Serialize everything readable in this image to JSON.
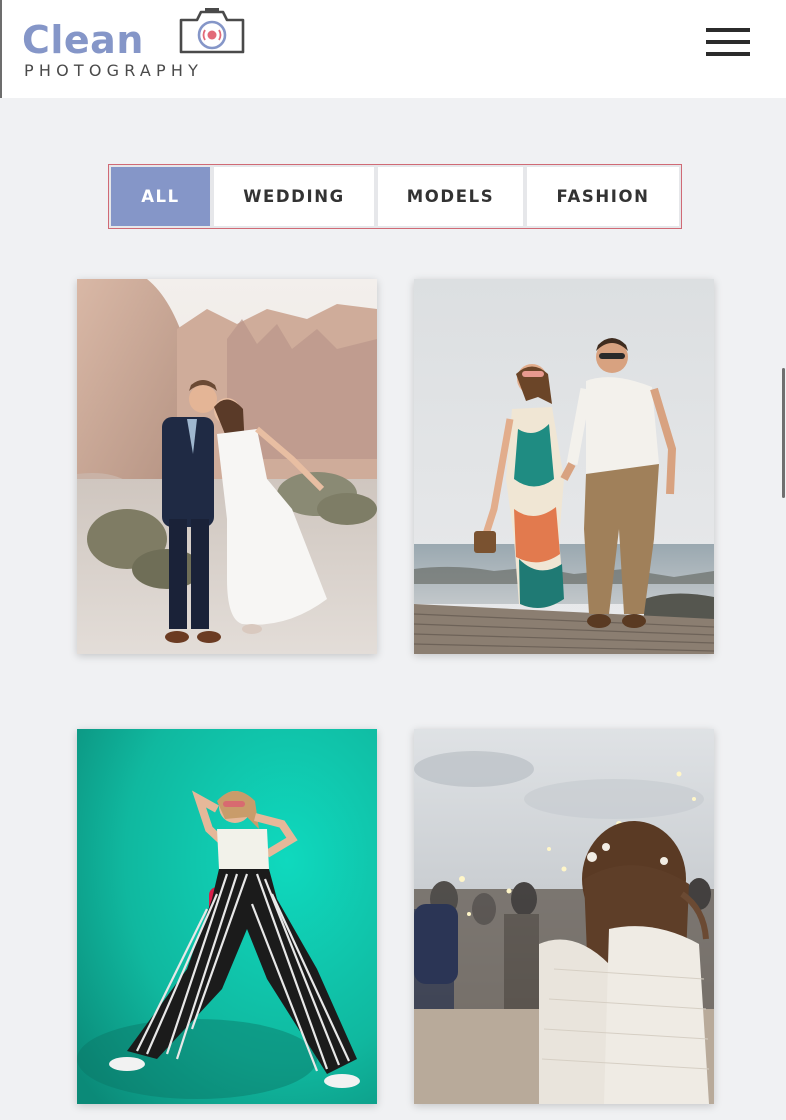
{
  "header": {
    "logo_word": "Clean",
    "logo_sub": "PHOTOGRAPHY",
    "menu_icon": "hamburger-icon"
  },
  "filters": {
    "items": [
      {
        "label": "ALL",
        "active": true
      },
      {
        "label": "WEDDING",
        "active": false
      },
      {
        "label": "MODELS",
        "active": false
      },
      {
        "label": "FASHION",
        "active": false
      }
    ]
  },
  "colors": {
    "accent": "#8596c8",
    "filter_border": "#d06a75",
    "page_bg": "#f0f1f3"
  }
}
